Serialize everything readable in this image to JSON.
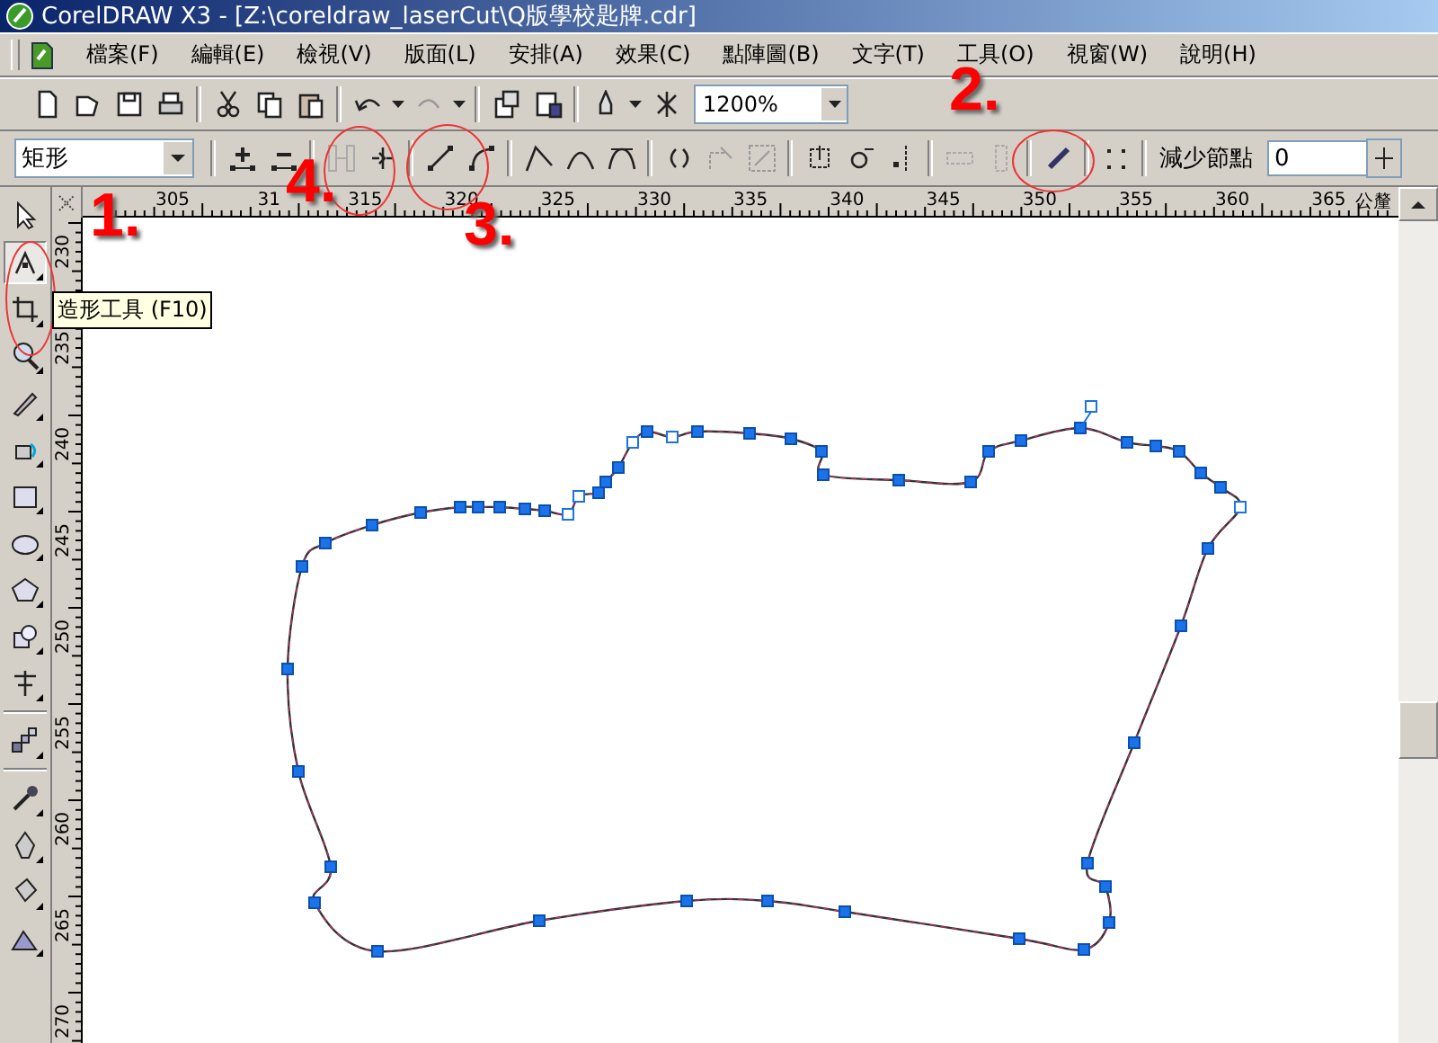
{
  "window": {
    "title": "CorelDRAW X3 - [Z:\\coreldraw_laserCut\\Q版學校匙牌.cdr]"
  },
  "menu": [
    "檔案(F)",
    "編輯(E)",
    "檢視(V)",
    "版面(L)",
    "安排(A)",
    "效果(C)",
    "點陣圖(B)",
    "文字(T)",
    "工具(O)",
    "視窗(W)",
    "說明(H)"
  ],
  "toolbar": {
    "zoom": "1200%"
  },
  "property_bar": {
    "shape_type": "矩形",
    "reduce_nodes_label": "減少節點",
    "reduce_nodes_value": "0"
  },
  "toolbox": [
    {
      "selected": false
    },
    {
      "selected": true
    },
    {
      "selected": false
    },
    {
      "selected": false
    },
    {
      "selected": false
    },
    {
      "selected": false
    },
    {
      "selected": false
    },
    {
      "selected": false
    },
    {
      "selected": false
    },
    {
      "selected": false
    },
    {
      "selected": false
    },
    {
      "selected": false
    },
    {
      "selected": false
    },
    {
      "selected": false
    },
    {
      "selected": false
    },
    {
      "selected": false
    }
  ],
  "ruler_h": {
    "labels": [
      "305",
      "31",
      "315",
      "320",
      "325",
      "330",
      "335",
      "340",
      "345",
      "350",
      "355",
      "360",
      "365"
    ],
    "unit": "公釐"
  },
  "ruler_v": {
    "labels": [
      "230",
      "235",
      "240",
      "245",
      "250",
      "255",
      "260",
      "265",
      "270"
    ]
  },
  "tooltip": "造形工具 (F10)",
  "annotations": [
    {
      "label": "1."
    },
    {
      "label": "2."
    },
    {
      "label": "3."
    },
    {
      "label": "4."
    }
  ]
}
